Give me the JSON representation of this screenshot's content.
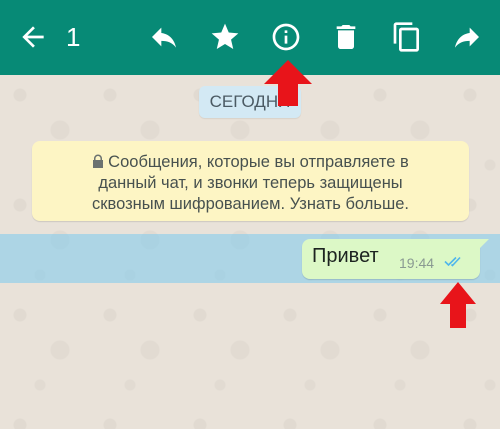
{
  "toolbar": {
    "selected_count": "1",
    "icons": [
      "back-arrow-icon",
      "reply-icon",
      "star-icon",
      "info-icon",
      "delete-icon",
      "copy-icon",
      "forward-icon"
    ],
    "background_color": "#078a76"
  },
  "chat": {
    "date_label": "СЕГОДНЯ",
    "encryption_notice": {
      "line1": "Сообщения, которые вы отправляете в",
      "line2": "данный чат, и звонки теперь защищены",
      "line3": "сквозным шифрованием. Узнать больше."
    },
    "message": {
      "text": "Привет",
      "time": "19:44",
      "status": "read",
      "selected": true
    }
  },
  "annotations": {
    "arrow_color": "#e8141a"
  }
}
